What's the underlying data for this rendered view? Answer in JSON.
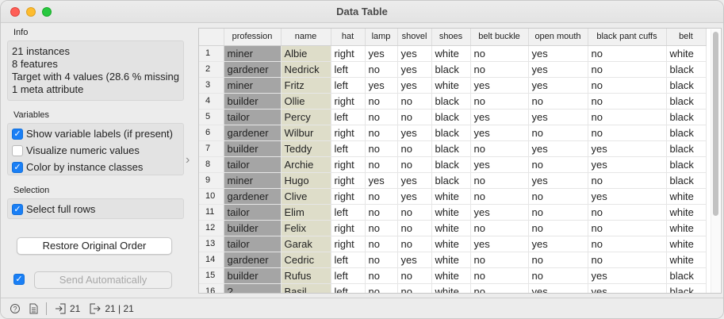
{
  "window": {
    "title": "Data Table"
  },
  "info": {
    "label": "Info",
    "lines": [
      "21 instances",
      "8 features",
      "Target with 4 values (28.6 % missing",
      "1 meta attribute"
    ]
  },
  "variables": {
    "label": "Variables",
    "show_labels": {
      "label": "Show variable labels (if present)",
      "checked": true
    },
    "visualize_numeric": {
      "label": "Visualize numeric values",
      "checked": false
    },
    "color_by_class": {
      "label": "Color by instance classes",
      "checked": true
    }
  },
  "selection": {
    "label": "Selection",
    "select_full_rows": {
      "label": "Select full rows",
      "checked": true
    }
  },
  "buttons": {
    "restore": "Restore Original Order",
    "send_auto": "Send Automatically",
    "send_auto_checked": true
  },
  "splitter_arrow": "›",
  "table": {
    "columns": [
      "profession",
      "name",
      "hat",
      "lamp",
      "shovel",
      "shoes",
      "belt buckle",
      "open mouth",
      "black pant cuffs",
      "belt"
    ],
    "rows": [
      [
        "1",
        "miner",
        "Albie",
        "right",
        "yes",
        "yes",
        "white",
        "no",
        "yes",
        "no",
        "white"
      ],
      [
        "2",
        "gardener",
        "Nedrick",
        "left",
        "no",
        "yes",
        "black",
        "no",
        "yes",
        "no",
        "black"
      ],
      [
        "3",
        "miner",
        "Fritz",
        "left",
        "yes",
        "yes",
        "white",
        "yes",
        "yes",
        "no",
        "black"
      ],
      [
        "4",
        "builder",
        "Ollie",
        "right",
        "no",
        "no",
        "black",
        "no",
        "no",
        "no",
        "black"
      ],
      [
        "5",
        "tailor",
        "Percy",
        "left",
        "no",
        "no",
        "black",
        "yes",
        "yes",
        "no",
        "black"
      ],
      [
        "6",
        "gardener",
        "Wilbur",
        "right",
        "no",
        "yes",
        "black",
        "yes",
        "no",
        "no",
        "black"
      ],
      [
        "7",
        "builder",
        "Teddy",
        "left",
        "no",
        "no",
        "black",
        "no",
        "yes",
        "yes",
        "black"
      ],
      [
        "8",
        "tailor",
        "Archie",
        "right",
        "no",
        "no",
        "black",
        "yes",
        "no",
        "yes",
        "black"
      ],
      [
        "9",
        "miner",
        "Hugo",
        "right",
        "yes",
        "yes",
        "black",
        "no",
        "yes",
        "no",
        "black"
      ],
      [
        "10",
        "gardener",
        "Clive",
        "right",
        "no",
        "yes",
        "white",
        "no",
        "no",
        "yes",
        "white"
      ],
      [
        "11",
        "tailor",
        "Elim",
        "left",
        "no",
        "no",
        "white",
        "yes",
        "no",
        "no",
        "white"
      ],
      [
        "12",
        "builder",
        "Felix",
        "right",
        "no",
        "no",
        "white",
        "no",
        "no",
        "no",
        "white"
      ],
      [
        "13",
        "tailor",
        "Garak",
        "right",
        "no",
        "no",
        "white",
        "yes",
        "yes",
        "no",
        "white"
      ],
      [
        "14",
        "gardener",
        "Cedric",
        "left",
        "no",
        "yes",
        "white",
        "no",
        "no",
        "no",
        "white"
      ],
      [
        "15",
        "builder",
        "Rufus",
        "left",
        "no",
        "no",
        "white",
        "no",
        "no",
        "yes",
        "black"
      ],
      [
        "16",
        "?",
        "Basil",
        "left",
        "no",
        "no",
        "white",
        "no",
        "yes",
        "yes",
        "black"
      ]
    ]
  },
  "status": {
    "help_icon": "?",
    "input_count": "21",
    "output_count": "21 | 21"
  },
  "colors": {
    "target_cell": "#a5a5a5",
    "meta_cell": "#deddc9",
    "checkbox_accent": "#1a7ff5"
  }
}
